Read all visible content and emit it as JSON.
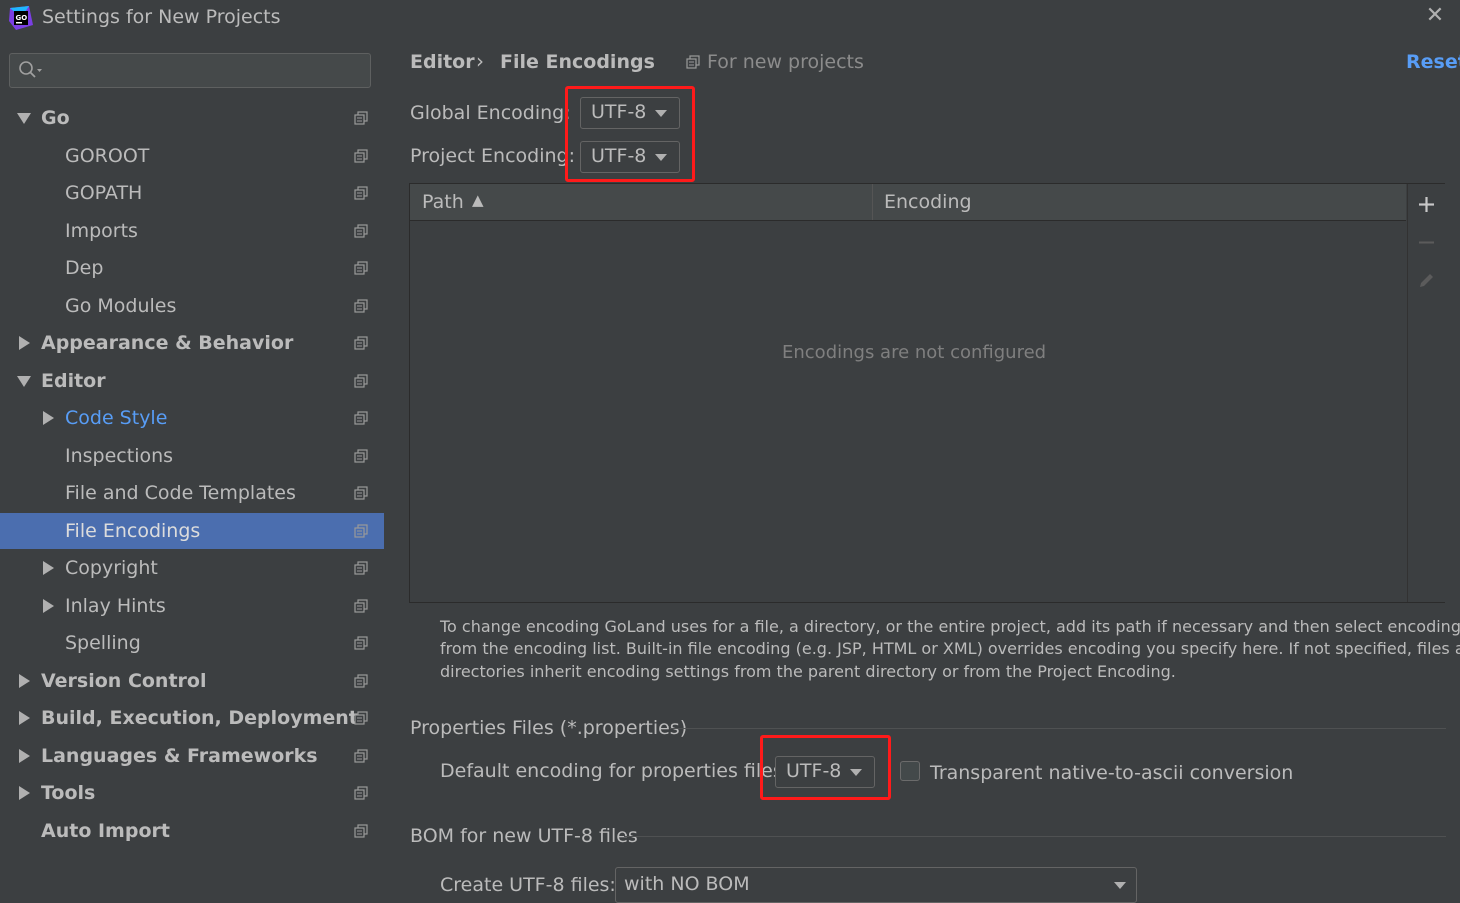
{
  "window": {
    "title": "Settings for New Projects",
    "close_glyph": "✕"
  },
  "search": {
    "value": ""
  },
  "sidebar": {
    "items": [
      {
        "label": "Go",
        "bold": true,
        "expanded": true,
        "selected": false
      },
      {
        "label": "GOROOT"
      },
      {
        "label": "GOPATH"
      },
      {
        "label": "Imports"
      },
      {
        "label": "Dep"
      },
      {
        "label": "Go Modules"
      },
      {
        "label": "Appearance & Behavior",
        "bold": true,
        "expanded": false
      },
      {
        "label": "Editor",
        "bold": true,
        "expanded": true
      },
      {
        "label": "Code Style",
        "expanded": false,
        "link": true
      },
      {
        "label": "Inspections"
      },
      {
        "label": "File and Code Templates"
      },
      {
        "label": "File Encodings",
        "selected": true
      },
      {
        "label": "Copyright",
        "expanded": false
      },
      {
        "label": "Inlay Hints",
        "expanded": false
      },
      {
        "label": "Spelling"
      },
      {
        "label": "Version Control",
        "bold": true,
        "expanded": false
      },
      {
        "label": "Build, Execution, Deployment",
        "bold": true,
        "expanded": false
      },
      {
        "label": "Languages & Frameworks",
        "bold": true,
        "expanded": false
      },
      {
        "label": "Tools",
        "bold": true,
        "expanded": false
      },
      {
        "label": "Auto Import",
        "bold": true
      }
    ]
  },
  "breadcrumb": {
    "parent": "Editor",
    "separator": "›",
    "current": "File Encodings",
    "scope_note": "For new projects"
  },
  "reset_label": "Reset",
  "global_encoding": {
    "label": "Global Encoding:",
    "value": "UTF-8"
  },
  "project_encoding": {
    "label": "Project Encoding:",
    "value": "UTF-8"
  },
  "table": {
    "columns": [
      "Path",
      "Encoding"
    ],
    "sort_indicator": "▲",
    "empty_text": "Encodings are not configured"
  },
  "help_text": {
    "line1": "To change encoding GoLand uses for a file, a directory, or the entire project, add its path if necessary and then select encoding",
    "line2": "from the encoding list. Built-in file encoding (e.g. JSP, HTML or XML) overrides encoding you specify here. If not specified, files and",
    "line3": "directories inherit encoding settings from the parent directory or from the Project Encoding."
  },
  "properties_section": {
    "title": "Properties Files (*.properties)",
    "default_label": "Default encoding for properties files:",
    "default_value": "UTF-8",
    "transparent_label": "Transparent native-to-ascii conversion",
    "transparent_checked": false
  },
  "bom_section": {
    "title": "BOM for new UTF-8 files",
    "create_label": "Create UTF-8 files:",
    "create_value": "with NO BOM"
  },
  "colors": {
    "background": "#3c3f41",
    "selection": "#4b6eaf",
    "link": "#589df6",
    "highlight_box": "#ff1a1a"
  }
}
